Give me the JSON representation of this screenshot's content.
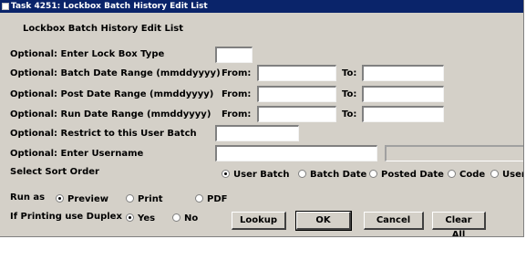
{
  "window": {
    "title": "Task 4251: Lockbox Batch History Edit List"
  },
  "header": "Lockbox Batch History Edit List",
  "fields": {
    "lockbox_type": {
      "label": "Optional: Enter Lock Box Type",
      "value": ""
    },
    "batch_date": {
      "label": "Optional: Batch Date Range (mmddyyyy)",
      "from_label": "From:",
      "to_label": "To:",
      "from": "",
      "to": ""
    },
    "post_date": {
      "label": "Optional: Post Date Range (mmddyyyy)",
      "from_label": "From:",
      "to_label": "To:",
      "from": "",
      "to": ""
    },
    "run_date": {
      "label": "Optional: Run Date Range (mmddyyyy)",
      "from_label": "From:",
      "to_label": "To:",
      "from": "",
      "to": ""
    },
    "user_batch": {
      "label": "Optional: Restrict to this User Batch",
      "value": ""
    },
    "username": {
      "label": "Optional:  Enter Username",
      "value": "",
      "display": ""
    }
  },
  "sort": {
    "label": "Select Sort Order",
    "options": [
      "User Batch",
      "Batch Date",
      "Posted Date",
      "Code",
      "User"
    ],
    "selected": "User Batch"
  },
  "run_as": {
    "label": "Run as",
    "options": [
      "Preview",
      "Print",
      "PDF"
    ],
    "selected": "Preview"
  },
  "duplex": {
    "label": "If Printing use Duplex",
    "options": [
      "Yes",
      "No"
    ],
    "selected": "Yes"
  },
  "buttons": {
    "lookup": "Lookup",
    "ok": "OK",
    "cancel": "Cancel",
    "clear_all": "Clear All"
  }
}
